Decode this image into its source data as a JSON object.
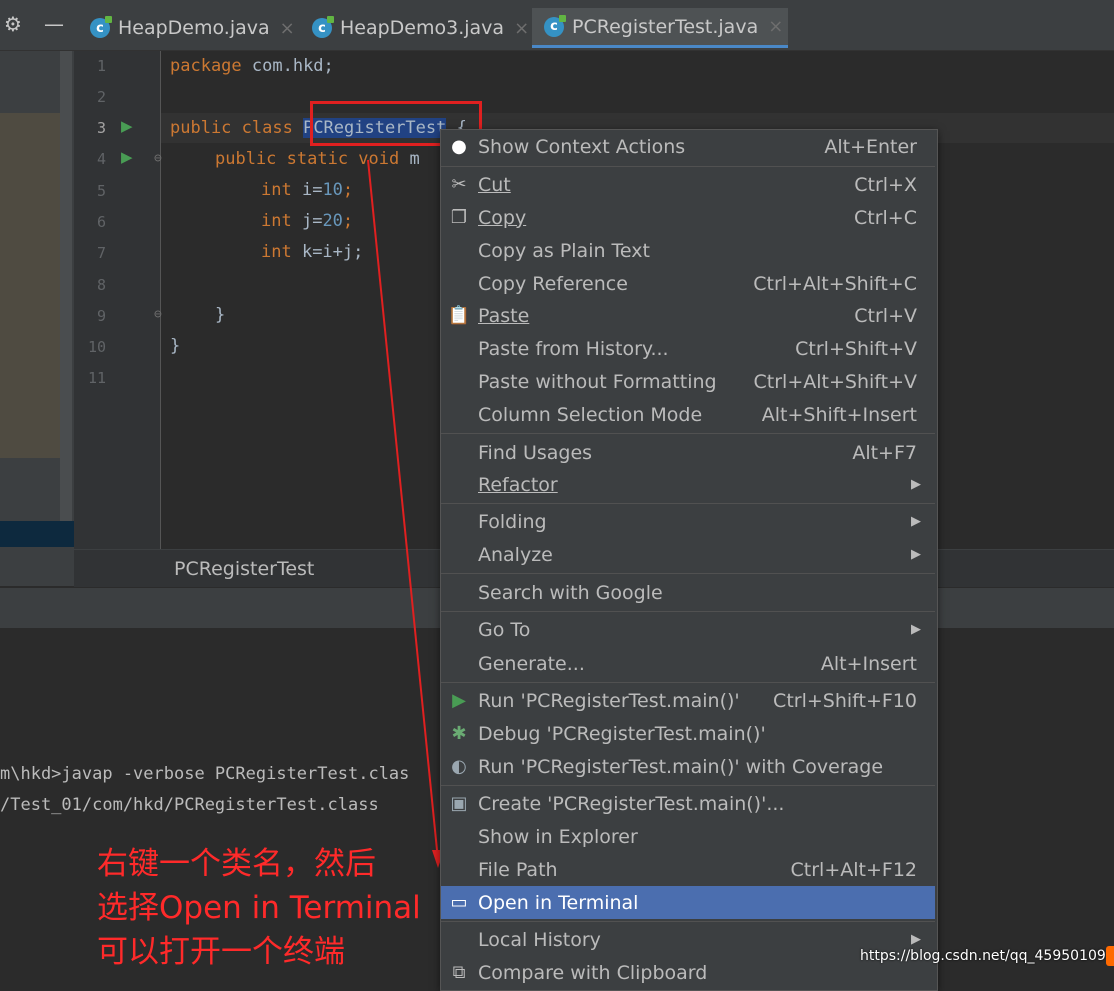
{
  "tabs": [
    {
      "label": "HeapDemo.java",
      "active": false
    },
    {
      "label": "HeapDemo3.java",
      "active": false
    },
    {
      "label": "PCRegisterTest.java",
      "active": true
    }
  ],
  "gutter": {
    "lines": [
      "1",
      "2",
      "3",
      "4",
      "5",
      "6",
      "7",
      "8",
      "9",
      "10",
      "11"
    ]
  },
  "code": {
    "line1_kw": "package",
    "line1_rest": " com.hkd;",
    "line3_kw": "public class",
    "line3_name": "PCRegisterTest",
    "line3_rest": " {",
    "line4_kw": "public static void",
    "line4_rest": " m",
    "line5_kw": "int",
    "line5_a": " i=",
    "line5_num": "10",
    "line5_b": ";",
    "line6_kw": "int",
    "line6_a": " j=",
    "line6_num": "20",
    "line6_b": ";",
    "line7_kw": "int",
    "line7_a": " k=i+j;",
    "line9": "}",
    "line10": "}"
  },
  "breadcrumb": "PCRegisterTest",
  "terminal": {
    "line1": "m\\hkd>javap -verbose PCRegisterTest.clas",
    "line2": "/Test_01/com/hkd/PCRegisterTest.class"
  },
  "annotation": {
    "line1": "右键一个类名，然后",
    "line2": "选择Open in Terminal",
    "line3": "可以打开一个终端"
  },
  "watermark": "https://blog.csdn.net/qq_45950109",
  "menu": {
    "items": [
      {
        "label": "Show Context Actions",
        "shortcut": "Alt+Enter",
        "icon": "bulb-icon"
      },
      {
        "label": "Cut",
        "shortcut": "Ctrl+X",
        "icon": "scissors-icon"
      },
      {
        "label": "Copy",
        "shortcut": "Ctrl+C",
        "icon": "copy-icon"
      },
      {
        "label": "Copy as Plain Text",
        "shortcut": ""
      },
      {
        "label": "Copy Reference",
        "shortcut": "Ctrl+Alt+Shift+C"
      },
      {
        "label": "Paste",
        "shortcut": "Ctrl+V",
        "icon": "clipboard-icon"
      },
      {
        "label": "Paste from History...",
        "shortcut": "Ctrl+Shift+V"
      },
      {
        "label": "Paste without Formatting",
        "shortcut": "Ctrl+Alt+Shift+V"
      },
      {
        "label": "Column Selection Mode",
        "shortcut": "Alt+Shift+Insert"
      },
      {
        "label": "Find Usages",
        "shortcut": "Alt+F7"
      },
      {
        "label": "Refactor",
        "submenu": true
      },
      {
        "label": "Folding",
        "submenu": true
      },
      {
        "label": "Analyze",
        "submenu": true
      },
      {
        "label": "Search with Google"
      },
      {
        "label": "Go To",
        "submenu": true
      },
      {
        "label": "Generate...",
        "shortcut": "Alt+Insert"
      },
      {
        "label": "Run 'PCRegisterTest.main()'",
        "shortcut": "Ctrl+Shift+F10",
        "icon": "run-icon"
      },
      {
        "label": "Debug 'PCRegisterTest.main()'",
        "icon": "debug-icon"
      },
      {
        "label": "Run 'PCRegisterTest.main()' with Coverage",
        "icon": "coverage-icon"
      },
      {
        "label": "Create 'PCRegisterTest.main()'...",
        "icon": "create-icon"
      },
      {
        "label": "Show in Explorer"
      },
      {
        "label": "File Path",
        "shortcut": "Ctrl+Alt+F12"
      },
      {
        "label": "Open in Terminal",
        "icon": "terminal-icon",
        "highlighted": true
      },
      {
        "label": "Local History",
        "submenu": true
      },
      {
        "label": "Compare with Clipboard",
        "icon": "compare-icon"
      }
    ]
  },
  "colors": {
    "accent": "#4b6eaf",
    "annotation": "#ff2a2a",
    "keyword": "#cc7832",
    "number": "#6897bb"
  }
}
